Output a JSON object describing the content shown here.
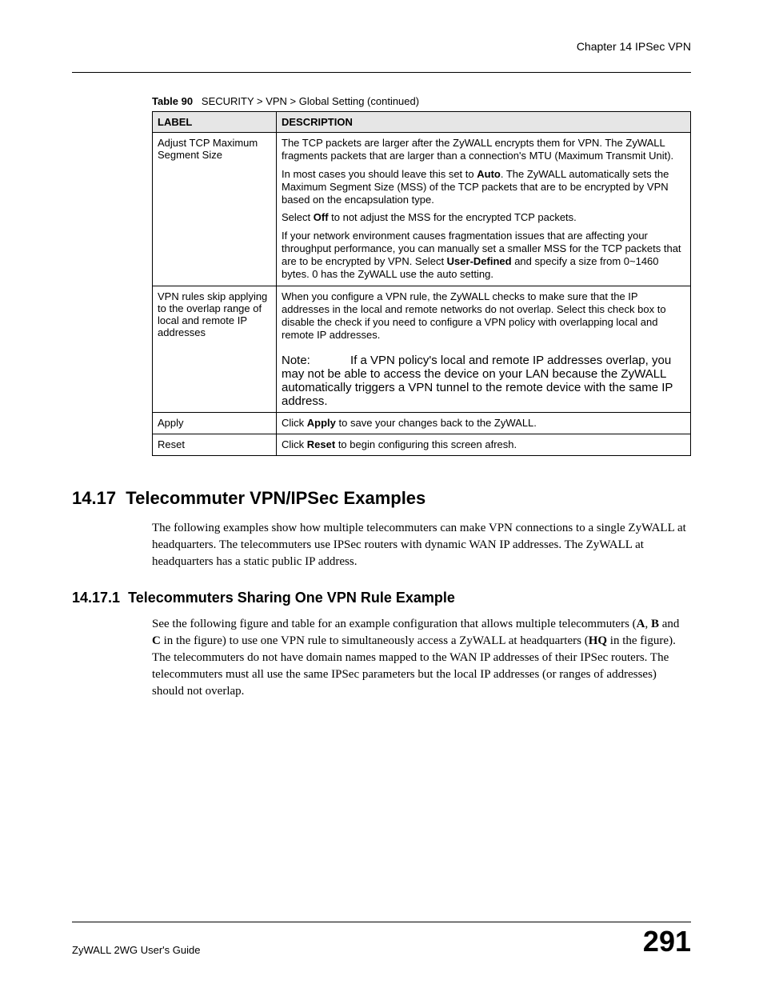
{
  "header": {
    "chapter": "Chapter 14 IPSec VPN"
  },
  "table": {
    "caption_num": "Table 90",
    "caption_text": "SECURITY > VPN > Global Setting (continued)",
    "head": {
      "label": "LABEL",
      "desc": "DESCRIPTION"
    },
    "rows": {
      "r1": {
        "label": "Adjust TCP Maximum Segment Size",
        "p1": "The TCP packets are larger after the ZyWALL encrypts them for VPN. The ZyWALL fragments packets that are larger than a connection's MTU (Maximum Transmit Unit).",
        "p2a": "In most cases you should leave this set to ",
        "p2b": "Auto",
        "p2c": ". The ZyWALL automatically sets the Maximum Segment Size (MSS) of the TCP packets that are to be encrypted by VPN based on the encapsulation type.",
        "p3a": "Select ",
        "p3b": "Off",
        "p3c": " to not adjust the MSS for the encrypted TCP packets.",
        "p4a": "If your network environment causes fragmentation issues that are affecting your throughput performance, you can manually set a smaller MSS for the TCP packets that are to be encrypted by VPN. Select ",
        "p4b": "User-Defined",
        "p4c": " and specify a size from 0~1460 bytes. 0 has the ZyWALL use the auto setting."
      },
      "r2": {
        "label": "VPN rules skip applying to the overlap range of local and remote IP addresses",
        "p1": "When you configure a VPN rule, the ZyWALL checks to make sure that the IP addresses in the local and remote networks do not overlap. Select this check box to disable the check if you need to configure a VPN policy with overlapping local and remote IP addresses.",
        "note_label": "Note: ",
        "note_body": "If a VPN policy's local and remote IP addresses overlap, you may not be able to access the device on your LAN because the ZyWALL automatically triggers a VPN tunnel to the remote device with the same IP address."
      },
      "r3": {
        "label": "Apply",
        "p1a": "Click ",
        "p1b": "Apply",
        "p1c": " to save your changes back to the ZyWALL."
      },
      "r4": {
        "label": "Reset",
        "p1a": "Click ",
        "p1b": "Reset",
        "p1c": " to begin configuring this screen afresh."
      }
    }
  },
  "section": {
    "num": "14.17",
    "title": "Telecommuter VPN/IPSec Examples",
    "para": "The following examples show how multiple telecommuters can make VPN connections to a single ZyWALL at headquarters. The telecommuters use IPSec routers with dynamic WAN IP addresses. The ZyWALL at headquarters has a static public IP address."
  },
  "subsection": {
    "num": "14.17.1",
    "title": "Telecommuters Sharing One VPN Rule Example",
    "para_parts": {
      "a": "See the following figure and table for an example configuration that allows multiple telecommuters (",
      "b": "A",
      "c": ", ",
      "d": "B",
      "e": " and ",
      "f": "C",
      "g": " in the figure) to use one VPN rule to simultaneously access a ZyWALL at headquarters (",
      "h": "HQ",
      "i": " in the figure). The telecommuters do not have domain names mapped to the WAN IP addresses of their IPSec routers. The telecommuters must all use the same IPSec parameters but the local IP addresses (or ranges of addresses) should not overlap."
    }
  },
  "footer": {
    "guide": "ZyWALL 2WG User's Guide",
    "page": "291"
  }
}
